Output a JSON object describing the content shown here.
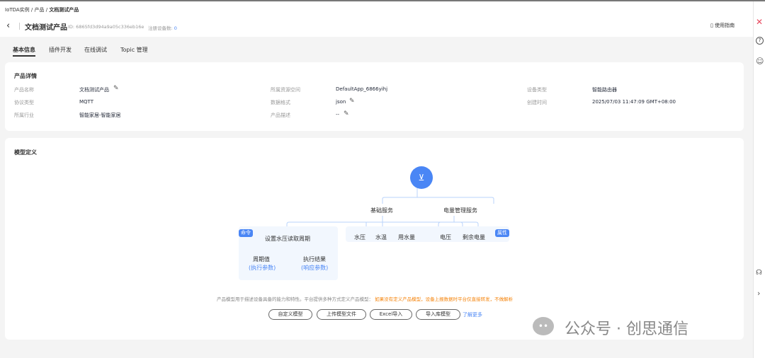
{
  "breadcrumb": [
    "IoTDA实例",
    "产品",
    "文档测试产品"
  ],
  "header": {
    "title": "文档测试产品",
    "id_text": "ID: 6865fd3d94a9a05c336eb16e",
    "registered_label": "注册设备数:",
    "registered_count": "0",
    "guide": "使用指南"
  },
  "tabs": [
    "基本信息",
    "插件开发",
    "在线调试",
    "Topic 管理"
  ],
  "details": {
    "title": "产品详情",
    "fields": [
      {
        "label": "产品名称",
        "value": "文档测试产品"
      },
      {
        "label": "所属资源空间",
        "value": "DefaultApp_6866yihj"
      },
      {
        "label": "设备类型",
        "value": "智能路由器"
      },
      {
        "label": "协议类型",
        "value": "MQTT"
      },
      {
        "label": "数据格式",
        "value": "json"
      },
      {
        "label": "创建时间",
        "value": "2025/07/03 11:47:09 GMT+08:00"
      },
      {
        "label": "所属行业",
        "value": "智能家居-智能家居"
      },
      {
        "label": "产品描述",
        "value": "--"
      }
    ]
  },
  "model": {
    "title": "模型定义",
    "services": [
      "基础服务",
      "电量管理服务"
    ],
    "command_tag": "命令",
    "property_tag": "属性",
    "command": "设置水压读取周期",
    "cmd_params": [
      {
        "name": "周期值",
        "type": "(执行参数)"
      },
      {
        "name": "执行结果",
        "type": "(响应参数)"
      }
    ],
    "props_basic": [
      "水压",
      "水温",
      "用水量"
    ],
    "props_power": [
      "电压",
      "剩余电量"
    ],
    "desc": "产品模型用于描述设备具备的能力和特性。平台提供多种方式定义产品模型：",
    "warn": "如果没有定义产品模型，设备上报数据时平台仅直接转发，不做解析",
    "buttons": [
      "自定义模型",
      "上传模型文件",
      "Excel导入",
      "导入库模型"
    ],
    "learn_more": "了解更多"
  },
  "watermark": "公众号 · 创思通信",
  "colors": {
    "accent": "#4a86f5",
    "warn": "#f5830a"
  }
}
